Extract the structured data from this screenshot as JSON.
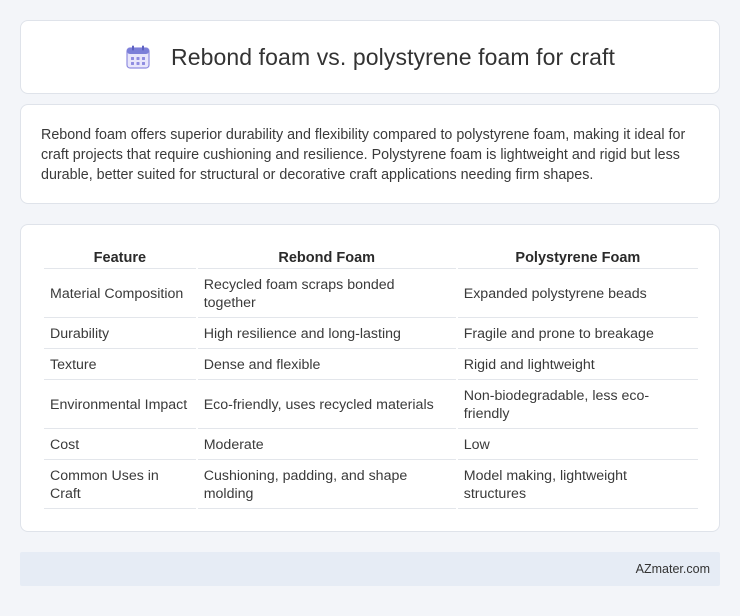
{
  "header": {
    "title": "Rebond foam vs. polystyrene foam for craft",
    "icon": "calendar-icon",
    "accent": "#7b7fd8"
  },
  "summary": {
    "text": "Rebond foam offers superior durability and flexibility compared to polystyrene foam, making it ideal for craft projects that require cushioning and resilience. Polystyrene foam is lightweight and rigid but less durable, better suited for structural or decorative craft applications needing firm shapes."
  },
  "table": {
    "headers": [
      "Feature",
      "Rebond Foam",
      "Polystyrene Foam"
    ],
    "rows": [
      [
        "Material Composition",
        "Recycled foam scraps bonded together",
        "Expanded polystyrene beads"
      ],
      [
        "Durability",
        "High resilience and long-lasting",
        "Fragile and prone to breakage"
      ],
      [
        "Texture",
        "Dense and flexible",
        "Rigid and lightweight"
      ],
      [
        "Environmental Impact",
        "Eco-friendly, uses recycled materials",
        "Non-biodegradable, less eco-friendly"
      ],
      [
        "Cost",
        "Moderate",
        "Low"
      ],
      [
        "Common Uses in Craft",
        "Cushioning, padding, and shape molding",
        "Model making, lightweight structures"
      ]
    ]
  },
  "footer": {
    "site": "AZmater.com"
  }
}
